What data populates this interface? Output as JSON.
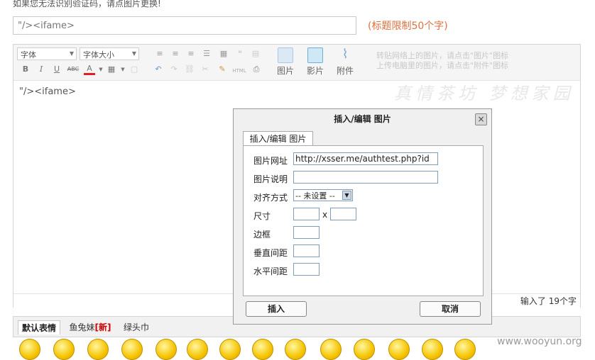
{
  "captcha_tip": "如果您无法识别验证码，请点图片更换!",
  "title": {
    "value": "\"/><ifame>",
    "limit_hint": "(标题限制50个字)"
  },
  "toolbar": {
    "font_family": "字体",
    "font_size": "字体大小",
    "image_label": "图片",
    "video_label": "影片",
    "attach_label": "附件",
    "hint_line1": "转贴网络上的图片，请点击\"图片\"图标",
    "hint_line2": "上传电脑里的图片，请点击\"附件\"图标",
    "bold": "B",
    "italic": "I",
    "underline": "U",
    "strike": "ABC",
    "color": "A",
    "html": "HTML"
  },
  "editor": {
    "content": "\"/><ifame>",
    "watermark": "真情茶坊 梦想家园",
    "char_count": "输入了 19个字"
  },
  "dialog": {
    "title": "插入/编辑 图片",
    "tab_label": "插入/编辑 图片",
    "close": "×",
    "fields": {
      "url_label": "图片网址",
      "url_value": "http://xsser.me/authtest.php?id",
      "desc_label": "图片说明",
      "align_label": "对齐方式",
      "align_value": "-- 未设置 --",
      "size_label": "尺寸",
      "size_sep": "x",
      "border_label": "边框",
      "vspace_label": "垂直间距",
      "hspace_label": "水平间距"
    },
    "insert_button": "插入",
    "cancel_button": "取消"
  },
  "emoji": {
    "tab_default": "默认表情",
    "tab_fish": "鱼兔妹",
    "tab_fish_new": "[新]",
    "tab_turtle": "绿头巾"
  },
  "source_watermark": "www.wooyun.org"
}
